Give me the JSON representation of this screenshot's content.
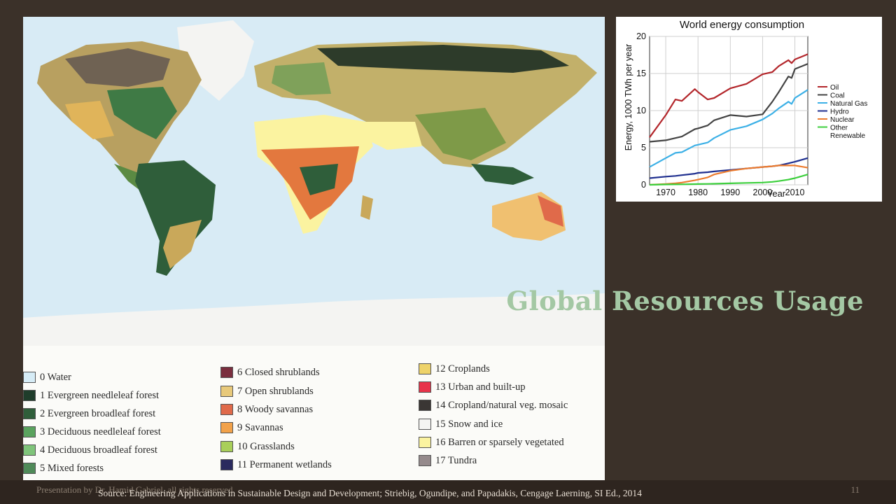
{
  "slide": {
    "title": "Global Resources Usage",
    "page_number": "11",
    "presenter_line": "Presentation by Dr. Hamid Gabriel, all rights reserved",
    "source": "Source: Engineering Applications in Sustainable Design and Development; Striebig, Ogundipe, and Papadakis, Cengage Laerning, SI Ed., 2014"
  },
  "map_legend": {
    "items": [
      {
        "label": "0 Water",
        "color": "#d6ecf6"
      },
      {
        "label": "1 Evergreen needleleaf forest",
        "color": "#1f3d2b"
      },
      {
        "label": "2 Evergreen broadleaf forest",
        "color": "#2f5e3a"
      },
      {
        "label": "3 Deciduous needleleaf forest",
        "color": "#5aa35e"
      },
      {
        "label": "4 Deciduous broadleaf forest",
        "color": "#7fc47a"
      },
      {
        "label": "5 Mixed forests",
        "color": "#4f8a58"
      },
      {
        "label": "6 Closed shrublands",
        "color": "#7a2e3e"
      },
      {
        "label": "7 Open shrublands",
        "color": "#e8c97a"
      },
      {
        "label": "8 Woody savannas",
        "color": "#e06a4a"
      },
      {
        "label": "9 Savannas",
        "color": "#f2a24a"
      },
      {
        "label": "10 Grasslands",
        "color": "#a9cf5a"
      },
      {
        "label": "11 Permanent wetlands",
        "color": "#2a2a5e"
      },
      {
        "label": "12 Croplands",
        "color": "#eed36a"
      },
      {
        "label": "13 Urban and built-up",
        "color": "#e8334a"
      },
      {
        "label": "14 Cropland/natural veg. mosaic",
        "color": "#3a3634"
      },
      {
        "label": "15 Snow and ice",
        "color": "#f4f4f2"
      },
      {
        "label": "16 Barren or sparsely vegetated",
        "color": "#fbf3a0"
      },
      {
        "label": "17 Tundra",
        "color": "#958a8c"
      }
    ]
  },
  "chart_data": {
    "type": "line",
    "title": "World energy consumption",
    "xlabel": "Year",
    "ylabel": "Energy, 1000 TWh per year",
    "xlim": [
      1965,
      2014
    ],
    "ylim": [
      0,
      20
    ],
    "x_ticks": [
      "1970",
      "1980",
      "1990",
      "2000",
      "2010"
    ],
    "y_ticks": [
      "0",
      "5",
      "10",
      "15",
      "20"
    ],
    "grid": true,
    "legend_position": "right",
    "x": [
      1965,
      1970,
      1973,
      1975,
      1979,
      1980,
      1983,
      1985,
      1990,
      1995,
      2000,
      2003,
      2005,
      2008,
      2009,
      2010,
      2014
    ],
    "series": [
      {
        "name": "Oil",
        "color": "#b3262b",
        "values": [
          6.4,
          9.4,
          11.5,
          11.3,
          12.9,
          12.5,
          11.5,
          11.7,
          13.0,
          13.6,
          14.9,
          15.2,
          16.0,
          16.8,
          16.4,
          16.9,
          17.6
        ]
      },
      {
        "name": "Coal",
        "color": "#444444",
        "values": [
          5.8,
          6.0,
          6.3,
          6.5,
          7.5,
          7.6,
          8.0,
          8.7,
          9.4,
          9.2,
          9.5,
          11.2,
          12.5,
          14.6,
          14.4,
          15.6,
          16.3
        ]
      },
      {
        "name": "Natural Gas",
        "color": "#3cb0e6",
        "values": [
          2.4,
          3.6,
          4.3,
          4.4,
          5.3,
          5.4,
          5.7,
          6.3,
          7.4,
          7.9,
          8.8,
          9.6,
          10.3,
          11.2,
          10.9,
          11.7,
          12.8
        ]
      },
      {
        "name": "Hydro",
        "color": "#1f2f8f",
        "values": [
          0.9,
          1.1,
          1.2,
          1.3,
          1.5,
          1.6,
          1.7,
          1.8,
          2.0,
          2.2,
          2.4,
          2.5,
          2.6,
          2.9,
          3.0,
          3.1,
          3.6
        ]
      },
      {
        "name": "Nuclear",
        "color": "#ec7b2e",
        "values": [
          0.0,
          0.1,
          0.2,
          0.3,
          0.6,
          0.7,
          1.0,
          1.4,
          1.9,
          2.2,
          2.4,
          2.5,
          2.6,
          2.6,
          2.6,
          2.6,
          2.3
        ]
      },
      {
        "name": "Other Renewable",
        "color": "#3ccf3c",
        "values": [
          0.0,
          0.05,
          0.06,
          0.07,
          0.09,
          0.1,
          0.12,
          0.14,
          0.2,
          0.25,
          0.3,
          0.4,
          0.5,
          0.7,
          0.8,
          0.9,
          1.4
        ]
      }
    ],
    "legend_labels": [
      "Oil",
      "Coal",
      "Natural Gas",
      "Hydro",
      "Nuclear",
      "Other",
      "Renewable"
    ]
  }
}
